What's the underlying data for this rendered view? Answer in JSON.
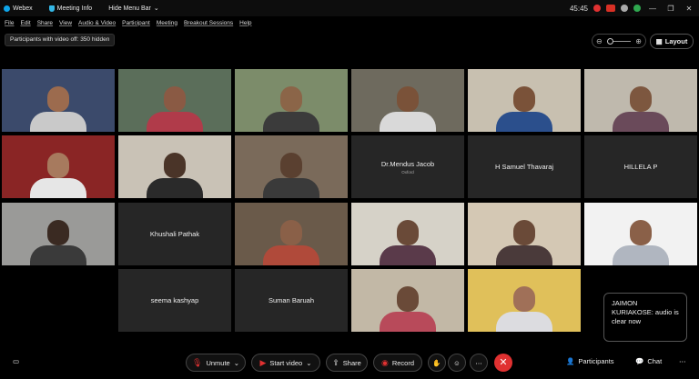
{
  "titlebar": {
    "app": "Webex",
    "meeting_info": "Meeting Info",
    "hide_menu": "Hide Menu Bar",
    "timer": "45:45",
    "chevron": "⌄"
  },
  "menu": [
    "File",
    "Edit",
    "Share",
    "View",
    "Audio & Video",
    "Participant",
    "Meeting",
    "Breakout Sessions",
    "Help"
  ],
  "hidden_notice": "Participants with video off: 350 hidden",
  "layout_label": "Layout",
  "tiles": [
    {
      "type": "video",
      "bg": "#3b4a6b",
      "skin": "#9c6b4e",
      "shirt": "#c9c9c9"
    },
    {
      "type": "video",
      "bg": "#5b6e5a",
      "skin": "#8a5a44",
      "shirt": "#b03b4a"
    },
    {
      "type": "video",
      "bg": "#7c8c6a",
      "skin": "#8b6548",
      "shirt": "#3b3b3b"
    },
    {
      "type": "video",
      "bg": "#6e6a5e",
      "skin": "#7a5239",
      "shirt": "#d9d9d9"
    },
    {
      "type": "video",
      "bg": "#c8c0b0",
      "skin": "#7a5239",
      "shirt": "#2b4f8c"
    },
    {
      "type": "video",
      "bg": "#bfb9ad",
      "skin": "#7d573f",
      "shirt": "#6a4a5a"
    },
    {
      "type": "video",
      "bg": "#8a2525",
      "skin": "#a77a5e",
      "shirt": "#e6e6e6"
    },
    {
      "type": "video",
      "bg": "#c9c2b6",
      "skin": "#4a3428",
      "shirt": "#2a2a2a"
    },
    {
      "type": "video",
      "bg": "#7a6a5a",
      "skin": "#5a4030",
      "shirt": "#3a3a3a"
    },
    {
      "type": "name",
      "name": "Dr.Mendus Jacob",
      "sub": "Oxford"
    },
    {
      "type": "name",
      "name": "H Samuel Thavaraj"
    },
    {
      "type": "name",
      "name": "HILLELA P"
    },
    {
      "type": "video",
      "bg": "#9a9a98",
      "skin": "#3a2a22",
      "shirt": "#3a3a3a"
    },
    {
      "type": "name",
      "name": "Khushali Pathak"
    },
    {
      "type": "video",
      "bg": "#6a5a4a",
      "skin": "#8a6048",
      "shirt": "#b04a3a"
    },
    {
      "type": "video",
      "bg": "#d6d2c8",
      "skin": "#6a4a38",
      "shirt": "#5a3a4a"
    },
    {
      "type": "video",
      "bg": "#d4c8b4",
      "skin": "#6a4a38",
      "shirt": "#4a3a3a"
    },
    {
      "type": "video",
      "bg": "#f2f2f2",
      "skin": "#8a6048",
      "shirt": "#b0b6c0"
    },
    {
      "type": "name",
      "name": "seema kashyap"
    },
    {
      "type": "name",
      "name": "Suman Baruah"
    },
    {
      "type": "video",
      "bg": "#c2b8a6",
      "skin": "#6a4a38",
      "shirt": "#b84a5a"
    },
    {
      "type": "video",
      "bg": "#e0c05a",
      "skin": "#a07058",
      "shirt": "#dcdce0"
    }
  ],
  "toast": "JAIMON KURIAKOSE: audio is clear now",
  "toolbar": {
    "unmute": "Unmute",
    "start_video": "Start video",
    "share": "Share",
    "record": "Record",
    "participants": "Participants",
    "chat": "Chat"
  }
}
